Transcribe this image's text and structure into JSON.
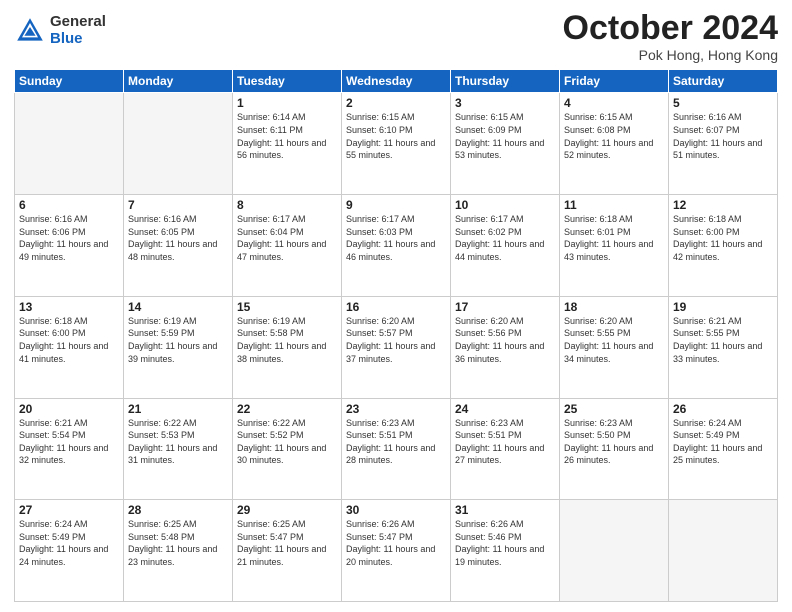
{
  "header": {
    "logo_general": "General",
    "logo_blue": "Blue",
    "title": "October 2024",
    "location": "Pok Hong, Hong Kong"
  },
  "weekdays": [
    "Sunday",
    "Monday",
    "Tuesday",
    "Wednesday",
    "Thursday",
    "Friday",
    "Saturday"
  ],
  "days": [
    {
      "num": "",
      "info": "",
      "empty": true
    },
    {
      "num": "",
      "info": "",
      "empty": true
    },
    {
      "num": "1",
      "info": "Sunrise: 6:14 AM\nSunset: 6:11 PM\nDaylight: 11 hours and 56 minutes."
    },
    {
      "num": "2",
      "info": "Sunrise: 6:15 AM\nSunset: 6:10 PM\nDaylight: 11 hours and 55 minutes."
    },
    {
      "num": "3",
      "info": "Sunrise: 6:15 AM\nSunset: 6:09 PM\nDaylight: 11 hours and 53 minutes."
    },
    {
      "num": "4",
      "info": "Sunrise: 6:15 AM\nSunset: 6:08 PM\nDaylight: 11 hours and 52 minutes."
    },
    {
      "num": "5",
      "info": "Sunrise: 6:16 AM\nSunset: 6:07 PM\nDaylight: 11 hours and 51 minutes."
    },
    {
      "num": "6",
      "info": "Sunrise: 6:16 AM\nSunset: 6:06 PM\nDaylight: 11 hours and 49 minutes."
    },
    {
      "num": "7",
      "info": "Sunrise: 6:16 AM\nSunset: 6:05 PM\nDaylight: 11 hours and 48 minutes."
    },
    {
      "num": "8",
      "info": "Sunrise: 6:17 AM\nSunset: 6:04 PM\nDaylight: 11 hours and 47 minutes."
    },
    {
      "num": "9",
      "info": "Sunrise: 6:17 AM\nSunset: 6:03 PM\nDaylight: 11 hours and 46 minutes."
    },
    {
      "num": "10",
      "info": "Sunrise: 6:17 AM\nSunset: 6:02 PM\nDaylight: 11 hours and 44 minutes."
    },
    {
      "num": "11",
      "info": "Sunrise: 6:18 AM\nSunset: 6:01 PM\nDaylight: 11 hours and 43 minutes."
    },
    {
      "num": "12",
      "info": "Sunrise: 6:18 AM\nSunset: 6:00 PM\nDaylight: 11 hours and 42 minutes."
    },
    {
      "num": "13",
      "info": "Sunrise: 6:18 AM\nSunset: 6:00 PM\nDaylight: 11 hours and 41 minutes."
    },
    {
      "num": "14",
      "info": "Sunrise: 6:19 AM\nSunset: 5:59 PM\nDaylight: 11 hours and 39 minutes."
    },
    {
      "num": "15",
      "info": "Sunrise: 6:19 AM\nSunset: 5:58 PM\nDaylight: 11 hours and 38 minutes."
    },
    {
      "num": "16",
      "info": "Sunrise: 6:20 AM\nSunset: 5:57 PM\nDaylight: 11 hours and 37 minutes."
    },
    {
      "num": "17",
      "info": "Sunrise: 6:20 AM\nSunset: 5:56 PM\nDaylight: 11 hours and 36 minutes."
    },
    {
      "num": "18",
      "info": "Sunrise: 6:20 AM\nSunset: 5:55 PM\nDaylight: 11 hours and 34 minutes."
    },
    {
      "num": "19",
      "info": "Sunrise: 6:21 AM\nSunset: 5:55 PM\nDaylight: 11 hours and 33 minutes."
    },
    {
      "num": "20",
      "info": "Sunrise: 6:21 AM\nSunset: 5:54 PM\nDaylight: 11 hours and 32 minutes."
    },
    {
      "num": "21",
      "info": "Sunrise: 6:22 AM\nSunset: 5:53 PM\nDaylight: 11 hours and 31 minutes."
    },
    {
      "num": "22",
      "info": "Sunrise: 6:22 AM\nSunset: 5:52 PM\nDaylight: 11 hours and 30 minutes."
    },
    {
      "num": "23",
      "info": "Sunrise: 6:23 AM\nSunset: 5:51 PM\nDaylight: 11 hours and 28 minutes."
    },
    {
      "num": "24",
      "info": "Sunrise: 6:23 AM\nSunset: 5:51 PM\nDaylight: 11 hours and 27 minutes."
    },
    {
      "num": "25",
      "info": "Sunrise: 6:23 AM\nSunset: 5:50 PM\nDaylight: 11 hours and 26 minutes."
    },
    {
      "num": "26",
      "info": "Sunrise: 6:24 AM\nSunset: 5:49 PM\nDaylight: 11 hours and 25 minutes."
    },
    {
      "num": "27",
      "info": "Sunrise: 6:24 AM\nSunset: 5:49 PM\nDaylight: 11 hours and 24 minutes."
    },
    {
      "num": "28",
      "info": "Sunrise: 6:25 AM\nSunset: 5:48 PM\nDaylight: 11 hours and 23 minutes."
    },
    {
      "num": "29",
      "info": "Sunrise: 6:25 AM\nSunset: 5:47 PM\nDaylight: 11 hours and 21 minutes."
    },
    {
      "num": "30",
      "info": "Sunrise: 6:26 AM\nSunset: 5:47 PM\nDaylight: 11 hours and 20 minutes."
    },
    {
      "num": "31",
      "info": "Sunrise: 6:26 AM\nSunset: 5:46 PM\nDaylight: 11 hours and 19 minutes."
    },
    {
      "num": "",
      "info": "",
      "empty": true
    },
    {
      "num": "",
      "info": "",
      "empty": true
    }
  ]
}
